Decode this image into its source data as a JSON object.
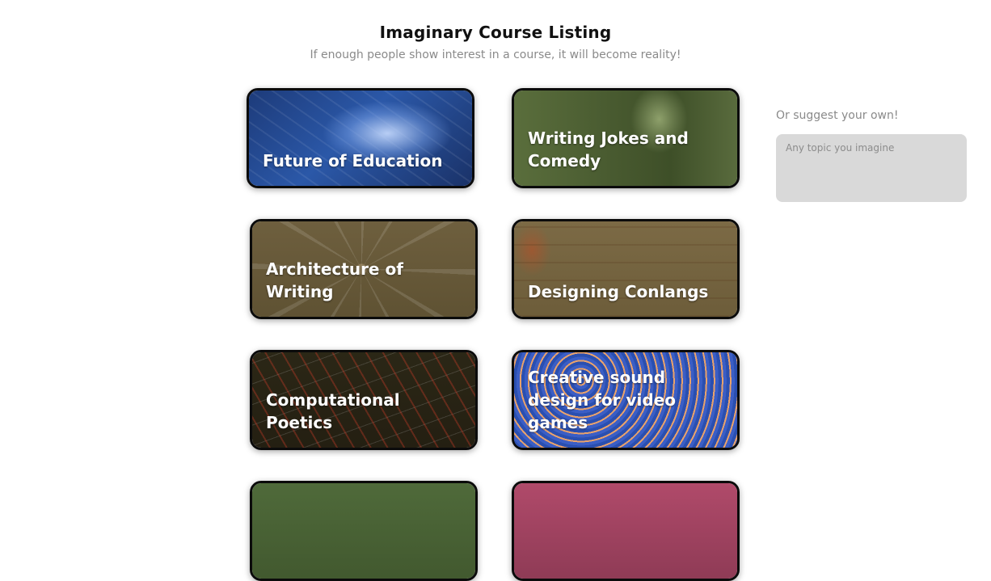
{
  "header": {
    "title": "Imaginary Course Listing",
    "subtitle": "If enough people show interest in a course, it will become reality!"
  },
  "courses": [
    {
      "label": "Future of Education",
      "bg": "#2b58a8"
    },
    {
      "label": "Writing Jokes and Comedy",
      "bg": "#5a6e3c"
    },
    {
      "label": "Architecture of Writing",
      "bg": "#6e5f3e"
    },
    {
      "label": "Designing Conlangs",
      "bg": "#7c6a45"
    },
    {
      "label": "Computational Poetics",
      "bg": "#2b2716"
    },
    {
      "label": "Creative sound design for video games",
      "bg": "#2a48a4"
    },
    {
      "label": "",
      "bg": "#4f6a3a"
    },
    {
      "label": "",
      "bg": "#b04a6a"
    }
  ],
  "suggest": {
    "label": "Or suggest your own!",
    "placeholder": "Any topic you imagine"
  }
}
